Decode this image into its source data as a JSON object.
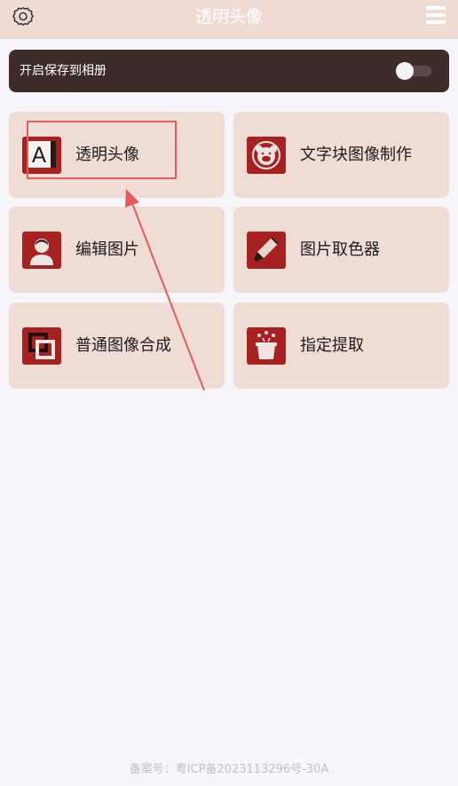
{
  "header": {
    "title": "透明头像",
    "settings_icon": "gear-icon",
    "menu_icon": "hamburger-menu-icon"
  },
  "save_bar": {
    "label": "开启保存到相册",
    "toggle_on": false
  },
  "tools": [
    {
      "label": "透明头像",
      "icon": "letter-a-icon"
    },
    {
      "label": "文字块图像制作",
      "icon": "pig-face-icon"
    },
    {
      "label": "编辑图片",
      "icon": "person-portrait-icon"
    },
    {
      "label": "图片取色器",
      "icon": "color-picker-pen-icon"
    },
    {
      "label": "普通图像合成",
      "icon": "overlapping-squares-icon"
    },
    {
      "label": "指定提取",
      "icon": "magic-hat-icon"
    }
  ],
  "footer": {
    "icp": "备案号：粤ICP备2023113296号-30A"
  },
  "colors": {
    "header_bg": "#efdbd4",
    "card_bg": "#efdcd4",
    "icon_bg": "#a72121",
    "save_bar_bg": "#3e2c2a",
    "annotation": "#e65a5a"
  }
}
